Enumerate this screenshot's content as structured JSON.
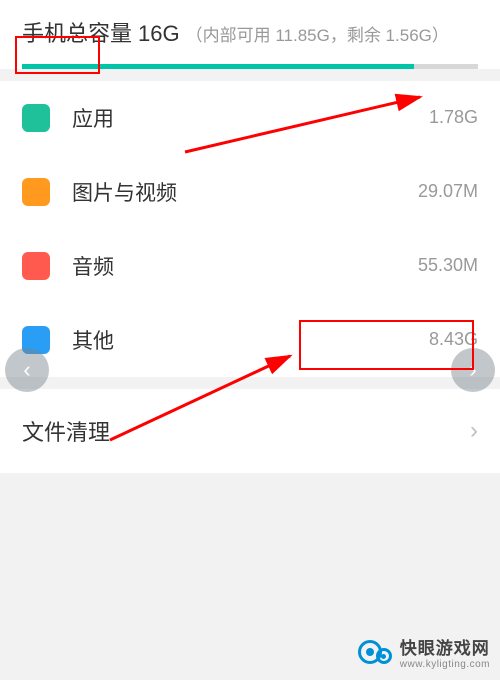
{
  "header": {
    "title_prefix": "手机总容量",
    "capacity": "16G",
    "detail": "（内部可用 11.85G，剩余 1.56G）",
    "progress_pct": 86
  },
  "categories": [
    {
      "key": "apps",
      "label": "应用",
      "value": "1.78G"
    },
    {
      "key": "media",
      "label": "图片与视频",
      "value": "29.07M"
    },
    {
      "key": "audio",
      "label": "音频",
      "value": "55.30M"
    },
    {
      "key": "other",
      "label": "其他",
      "value": "8.43G"
    }
  ],
  "cleanup": {
    "label": "文件清理"
  },
  "watermark": {
    "name": "快眼游戏网",
    "url": "www.kyligting.com"
  },
  "annotations": {
    "highlight_remaining": true,
    "highlight_other_value": true,
    "arrows": 2
  }
}
